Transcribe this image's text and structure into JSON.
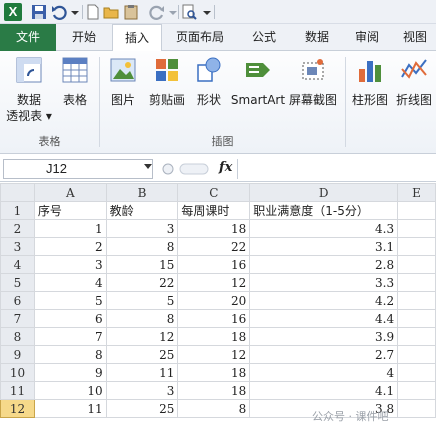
{
  "quick_access": {
    "logo": "X",
    "icons": [
      "excel-logo",
      "save-icon",
      "undo-icon",
      "new-file-icon",
      "open-folder-icon",
      "redo-icon",
      "print-preview-icon",
      "customize-icon"
    ]
  },
  "tabs": [
    "文件",
    "开始",
    "插入",
    "页面布局",
    "公式",
    "数据",
    "审阅",
    "视图"
  ],
  "ribbon": {
    "buttons": [
      {
        "label": "数据",
        "label2": "透视表 ▾",
        "icon": "pivot-table-icon"
      },
      {
        "label": "表格",
        "icon": "table-icon"
      },
      {
        "label": "图片",
        "icon": "picture-icon"
      },
      {
        "label": "剪贴画",
        "icon": "clip-art-icon"
      },
      {
        "label": "形状",
        "icon": "shapes-icon"
      },
      {
        "label": "SmartArt",
        "icon": "smartart-icon"
      },
      {
        "label": "屏幕截图",
        "icon": "screenshot-icon"
      },
      {
        "label": "柱形图",
        "icon": "column-chart-icon"
      },
      {
        "label": "折线图",
        "icon": "line-chart-icon"
      }
    ],
    "groups": [
      "表格",
      "插图"
    ]
  },
  "formula_bar": {
    "name_box": "J12",
    "fx": "fx",
    "content": ""
  },
  "columns": [
    "A",
    "B",
    "C",
    "D",
    "E"
  ],
  "rows": [
    {
      "n": "1",
      "a": "序号",
      "b": "教龄",
      "c": "每周课时",
      "d": "职业满意度（1-5分）",
      "header": true
    },
    {
      "n": "2",
      "a": "1",
      "b": "3",
      "c": "18",
      "d": "4.3"
    },
    {
      "n": "3",
      "a": "2",
      "b": "8",
      "c": "22",
      "d": "3.1"
    },
    {
      "n": "4",
      "a": "3",
      "b": "15",
      "c": "16",
      "d": "2.8"
    },
    {
      "n": "5",
      "a": "4",
      "b": "22",
      "c": "12",
      "d": "3.3"
    },
    {
      "n": "6",
      "a": "5",
      "b": "5",
      "c": "20",
      "d": "4.2"
    },
    {
      "n": "7",
      "a": "6",
      "b": "8",
      "c": "16",
      "d": "4.4"
    },
    {
      "n": "8",
      "a": "7",
      "b": "12",
      "c": "18",
      "d": "3.9"
    },
    {
      "n": "9",
      "a": "8",
      "b": "25",
      "c": "12",
      "d": "2.7"
    },
    {
      "n": "10",
      "a": "9",
      "b": "11",
      "c": "18",
      "d": "4"
    },
    {
      "n": "11",
      "a": "10",
      "b": "3",
      "c": "18",
      "d": "4.1"
    },
    {
      "n": "12",
      "a": "11",
      "b": "25",
      "c": "8",
      "d": "3.8"
    }
  ],
  "watermark": "公众号 · 课件吧"
}
